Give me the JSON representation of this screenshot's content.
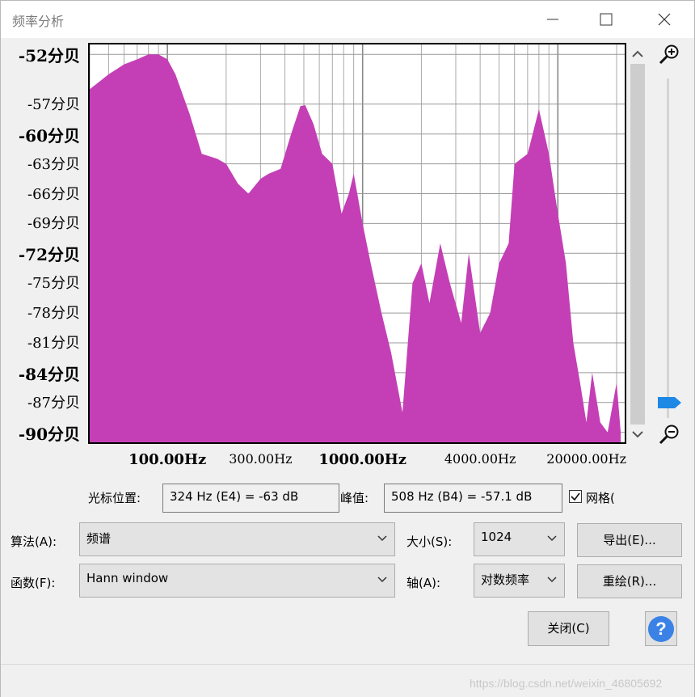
{
  "window": {
    "title": "频率分析",
    "controls": {
      "minimize": "minimize-icon",
      "maximize": "maximize-icon",
      "close": "close-icon"
    }
  },
  "plot": {
    "y_labels": [
      {
        "text": "-52分贝",
        "major": true
      },
      {
        "text": "-57分贝",
        "major": false
      },
      {
        "text": "-60分贝",
        "major": true
      },
      {
        "text": "-63分贝",
        "major": false
      },
      {
        "text": "-66分贝",
        "major": false
      },
      {
        "text": "-69分贝",
        "major": false
      },
      {
        "text": "-72分贝",
        "major": true
      },
      {
        "text": "-75分贝",
        "major": false
      },
      {
        "text": "-78分贝",
        "major": false
      },
      {
        "text": "-81分贝",
        "major": false
      },
      {
        "text": "-84分贝",
        "major": true
      },
      {
        "text": "-87分贝",
        "major": false
      },
      {
        "text": "-90分贝",
        "major": true
      }
    ],
    "x_labels": [
      {
        "text": "100.00Hz",
        "major": true
      },
      {
        "text": "300.00Hz",
        "major": false
      },
      {
        "text": "1000.00Hz",
        "major": true
      },
      {
        "text": "4000.00Hz",
        "major": false
      },
      {
        "text": "20000.00Hz",
        "major": false
      }
    ],
    "fill_color": "#c43fb6"
  },
  "chart_data": {
    "type": "area",
    "xscale": "log",
    "xlim": [
      40,
      22000
    ],
    "ylim": [
      -91,
      -51
    ],
    "grid": true,
    "x": [
      40,
      50,
      60,
      70,
      80,
      90,
      100,
      110,
      130,
      150,
      180,
      200,
      230,
      260,
      300,
      330,
      380,
      430,
      480,
      508,
      560,
      620,
      700,
      780,
      850,
      900,
      1000,
      1100,
      1250,
      1400,
      1600,
      1800,
      2000,
      2200,
      2500,
      2800,
      3200,
      3500,
      4000,
      4500,
      5000,
      5600,
      6000,
      7000,
      8000,
      9000,
      10000,
      11000,
      12000,
      13000,
      14000,
      15000,
      16500,
      18000,
      20000,
      21000
    ],
    "values": [
      -55.5,
      -54,
      -53,
      -52.5,
      -52,
      -52,
      -52.5,
      -54,
      -58,
      -62,
      -62.5,
      -63,
      -65,
      -66,
      -64.5,
      -64,
      -63.5,
      -60,
      -57.2,
      -57.1,
      -59,
      -62,
      -63,
      -68,
      -66,
      -64,
      -69,
      -73,
      -78,
      -82,
      -88,
      -75,
      -73,
      -77,
      -71,
      -75,
      -79,
      -72,
      -80,
      -78,
      -73,
      -71,
      -63,
      -62,
      -57.5,
      -62,
      -68,
      -73,
      -81,
      -85,
      -89,
      -84,
      -89,
      -90,
      -85,
      -90
    ]
  },
  "cursor": {
    "label": "光标位置:",
    "value": "324 Hz (E4) = -63 dB"
  },
  "peak": {
    "label": "峰值:",
    "value": "508 Hz (B4) = -57.1 dB"
  },
  "grid_checkbox": {
    "label": "网格(",
    "checked": true
  },
  "algorithm": {
    "label": "算法(A):",
    "value": "频谱"
  },
  "size": {
    "label": "大小(S):",
    "value": "1024"
  },
  "function": {
    "label": "函数(F):",
    "value": "Hann window"
  },
  "axis": {
    "label": "轴(A):",
    "value": "对数频率"
  },
  "buttons": {
    "export": "导出(E)...",
    "redraw": "重绘(R)...",
    "close": "关闭(C)",
    "help": "?"
  },
  "watermark": "https://blog.csdn.net/weixin_46805692"
}
